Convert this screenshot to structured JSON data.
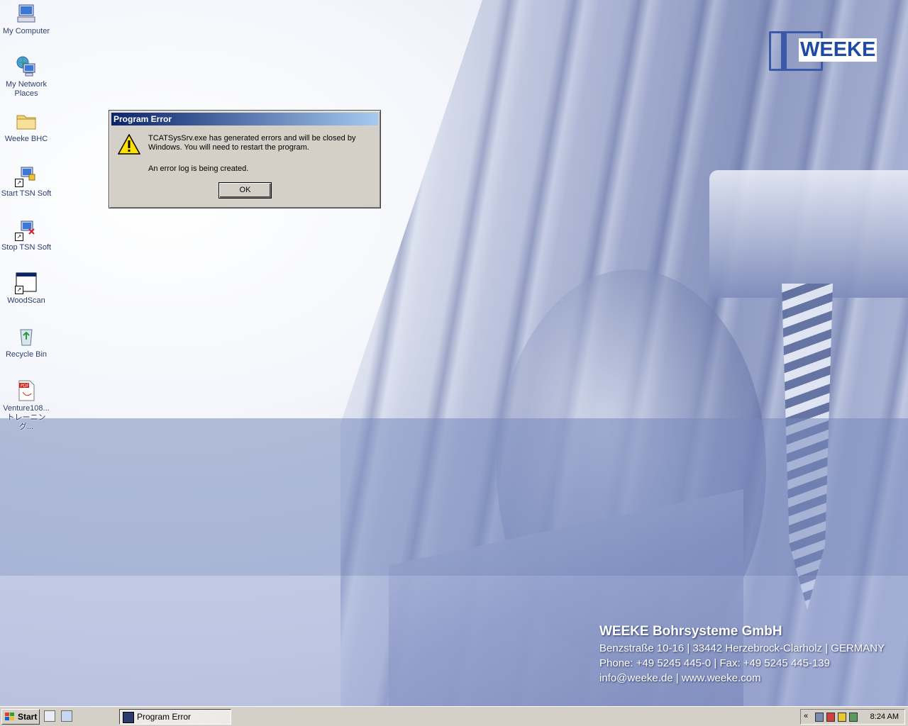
{
  "desktop": {
    "icons": [
      {
        "label": "My Computer",
        "icon": "my-computer-icon"
      },
      {
        "label": "My Network Places",
        "icon": "network-places-icon"
      },
      {
        "label": "Weeke BHC",
        "icon": "folder-icon"
      },
      {
        "label": "Start TSN Soft",
        "icon": "start-tsn-icon"
      },
      {
        "label": "Stop TSN Soft",
        "icon": "stop-tsn-icon"
      },
      {
        "label": "WoodScan",
        "icon": "woodscan-icon"
      },
      {
        "label": "Recycle Bin",
        "icon": "recycle-bin-icon"
      },
      {
        "label": "Venture108...\nトレーニング...",
        "icon": "pdf-icon"
      }
    ]
  },
  "wallpaper": {
    "logo_text": "WEEKE",
    "company_name": "WEEKE Bohrsysteme GmbH",
    "address": "Benzstraße 10-16 | 33442 Herzebrock-Clarholz | GERMANY",
    "phone": "Phone: +49 5245 445-0 | Fax: +49 5245 445-139",
    "web": "info@weeke.de | www.weeke.com"
  },
  "dialog": {
    "title": "Program Error",
    "message": "TCATSysSrv.exe has generated errors and will be closed by Windows.  You will need to restart the program.",
    "message2": "An error log is being created.",
    "ok_label": "OK",
    "icon": "warning-icon"
  },
  "taskbar": {
    "start_label": "Start",
    "task_label": "Program Error",
    "clock": "8:24 AM",
    "tray_chevron": "«"
  },
  "colors": {
    "titlebar_start": "#0a246a",
    "titlebar_end": "#a6caf0",
    "taskbar": "#d4d0c8"
  }
}
